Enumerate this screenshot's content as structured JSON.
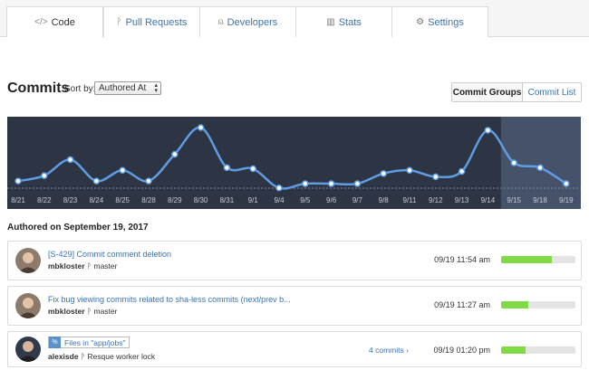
{
  "tabs": [
    {
      "label": "Code",
      "icon": "code-icon",
      "glyph": "</>"
    },
    {
      "label": "Pull Requests",
      "icon": "pull-request-icon",
      "glyph": "ᚹ"
    },
    {
      "label": "Developers",
      "icon": "user-icon",
      "glyph": "⍝"
    },
    {
      "label": "Stats",
      "icon": "bar-chart-icon",
      "glyph": "▥"
    },
    {
      "label": "Settings",
      "icon": "gear-icon",
      "glyph": "⚙"
    }
  ],
  "header": {
    "title": "Commits",
    "sort_label": "Sort by:",
    "sort_value": "Authored At"
  },
  "view_toggle": {
    "groups": "Commit Groups",
    "list": "Commit List"
  },
  "chart_data": {
    "type": "line",
    "categories": [
      "8/21",
      "8/22",
      "8/23",
      "8/24",
      "8/25",
      "8/28",
      "8/29",
      "8/30",
      "8/31",
      "9/1",
      "9/4",
      "9/5",
      "9/6",
      "9/7",
      "9/8",
      "9/11",
      "9/12",
      "9/13",
      "9/14",
      "9/15",
      "9/18",
      "9/19"
    ],
    "values": [
      1,
      2,
      5,
      1,
      3,
      1,
      6,
      11,
      3.5,
      3.3,
      -0.3,
      0.5,
      0.5,
      0.5,
      2.4,
      3,
      1.8,
      2.8,
      10.5,
      4.4,
      3.5,
      0.5
    ],
    "highlight_range": [
      "9/15",
      "9/19"
    ],
    "colors": {
      "background": "#2d3443",
      "highlight": "#455269",
      "line": "#5e9de3",
      "point_fill": "#ffffff",
      "tick": "#c7ccd6"
    }
  },
  "section_title": "Authored on September 19, 2017",
  "commits": [
    {
      "message": "[S-429] Commit comment deletion",
      "author": "mbkloster",
      "branch": "master",
      "time": "09/19 11:54 am",
      "progress": 0.68
    },
    {
      "message": "Fix bug viewing commits related to sha-less commits (next/prev b...",
      "author": "mbkloster",
      "branch": "master",
      "time": "09/19 11:27 am",
      "progress": 0.37
    },
    {
      "message": "Files in \"app/jobs\"",
      "author": "alexisde",
      "branch": "Resque worker lock",
      "commits_link": "4 commits ›",
      "time": "09/19 01:20 pm",
      "progress": 0.33
    }
  ],
  "branch_glyph": "ᚹ",
  "file_glyph": "%"
}
